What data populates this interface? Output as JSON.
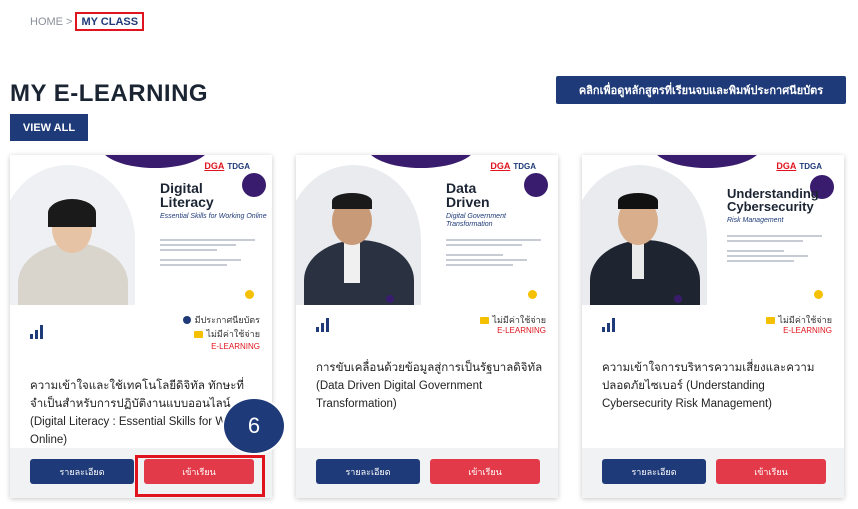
{
  "breadcrumb": {
    "home": "HOME",
    "separator": ">",
    "current": "MY CLASS"
  },
  "page": {
    "title": "MY E-LEARNING",
    "view_all": "VIEW ALL",
    "certificate_button": "คลิกเพื่อดูหลักสูตรที่เรียนจบและพิมพ์ประกาศนียบัตร"
  },
  "logos": {
    "dga": "DGA",
    "tdga": "TDGA"
  },
  "cards": [
    {
      "image_title_line1": "Digital",
      "image_title_line2": "Literacy",
      "image_subtitle": "Essential Skills for Working Online",
      "has_certificate": "มีประกาศนียบัตร",
      "price": "ไม่มีค่าใช้จ่าย",
      "type": "E-LEARNING",
      "description": "ความเข้าใจและใช้เทคโนโลยีดิจิทัล ทักษะที่จำเป็นสำหรับการปฏิบัติงานแบบออนไลน์ (Digital Literacy : Essential Skills for Working Online)",
      "detail_button": "รายละเอียด",
      "enter_button": "เข้าเรียน"
    },
    {
      "image_title_line1": "Data",
      "image_title_line2": "Driven",
      "image_subtitle": "Digital Government Transformation",
      "price": "ไม่มีค่าใช้จ่าย",
      "type": "E-LEARNING",
      "description": "การขับเคลื่อนด้วยข้อมูลสู่การเป็นรัฐบาลดิจิทัล (Data Driven Digital Government Transformation)",
      "detail_button": "รายละเอียด",
      "enter_button": "เข้าเรียน"
    },
    {
      "image_title_line1": "Understanding",
      "image_title_line2": "Cybersecurity",
      "image_subtitle": "Risk Management",
      "price": "ไม่มีค่าใช้จ่าย",
      "type": "E-LEARNING",
      "description": "ความเข้าใจการบริหารความเสี่ยงและความปลอดภัยไซเบอร์ (Understanding Cybersecurity Risk Management)",
      "detail_button": "รายละเอียด",
      "enter_button": "เข้าเรียน"
    }
  ],
  "annotation": {
    "step": "6"
  },
  "colors": {
    "primary": "#1e3a78",
    "accent_red": "#e23a48",
    "highlight": "#e0141e",
    "purple": "#3a1c6e",
    "yellow": "#f5c000"
  }
}
